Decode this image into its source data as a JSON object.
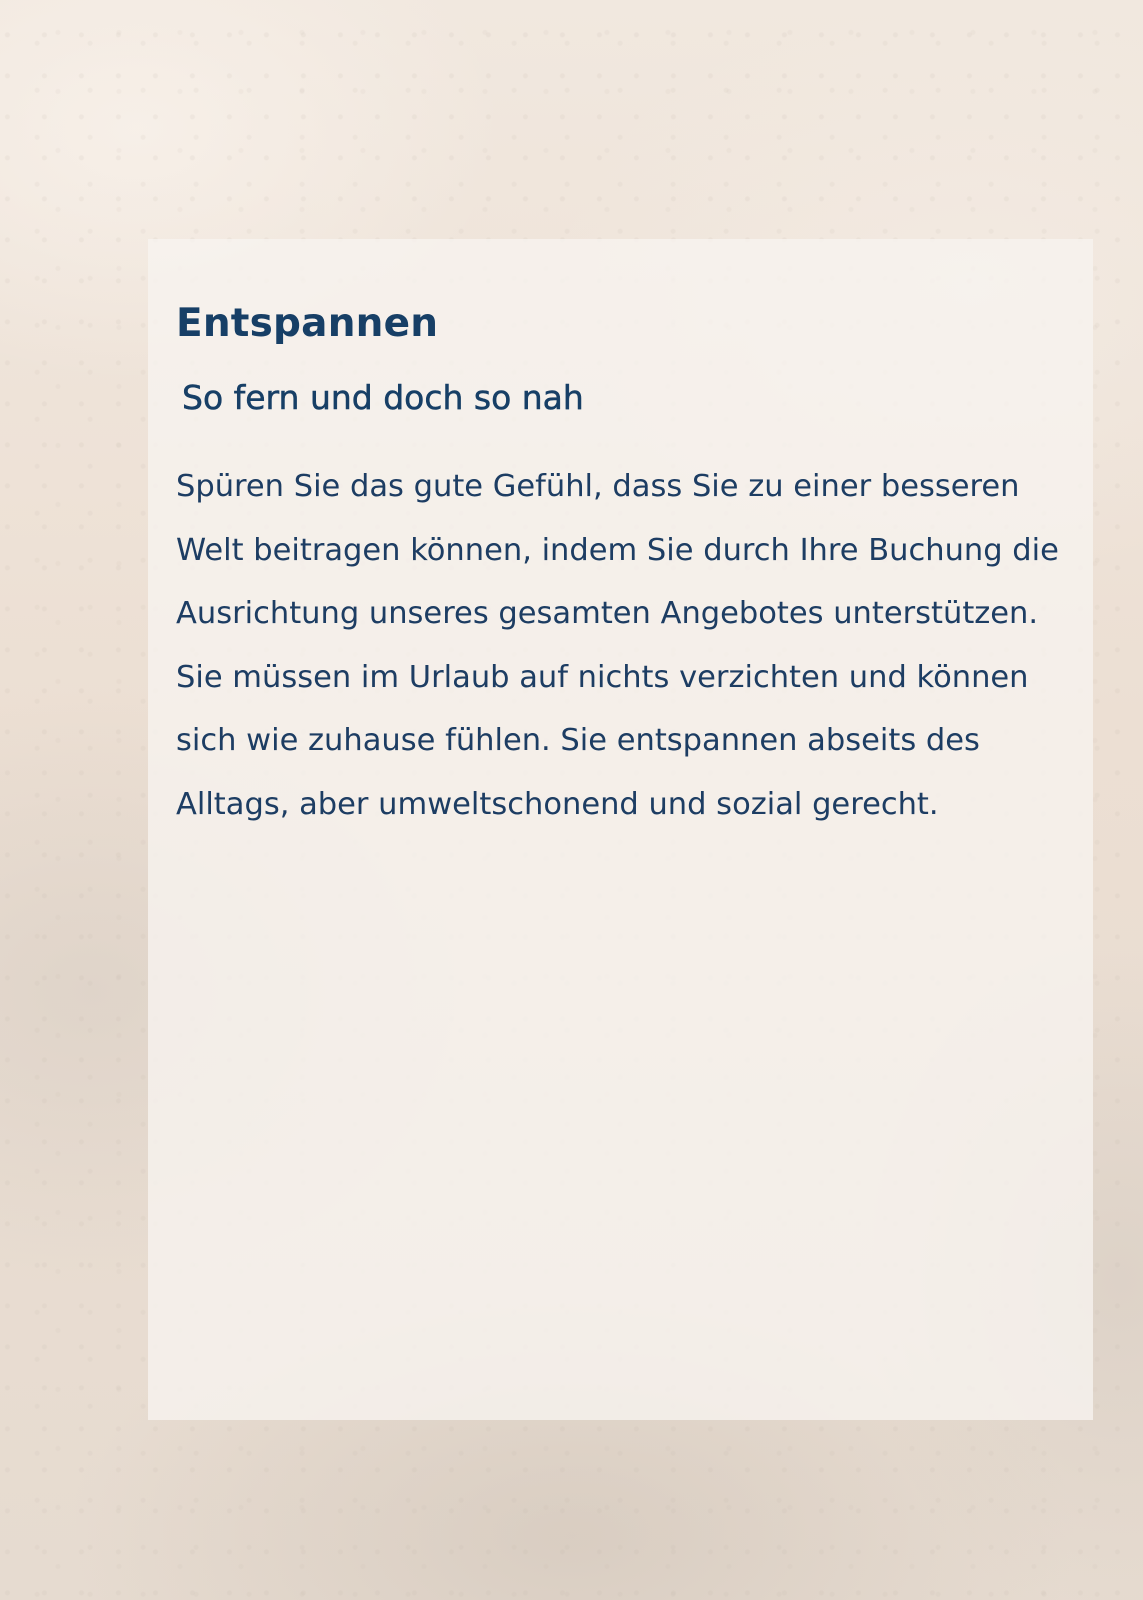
{
  "panel": {
    "heading": "Entspannen",
    "subheading": "So fern und doch so nah",
    "body": "Spüren Sie das gute Gefühl, dass Sie zu einer besseren Welt beitragen können, indem Sie durch Ihre Buchung die Ausrichtung unseres gesamten Angebotes unterstützen. Sie müssen im Urlaub auf nichts verzichten und können sich wie zuhause fühlen. Sie entspannen abseits des Alltags, aber umweltschonend und sozial gerecht."
  },
  "colors": {
    "text": "#173f66",
    "panel_background": "#f7f4f0",
    "page_background": "#ece1d6"
  }
}
